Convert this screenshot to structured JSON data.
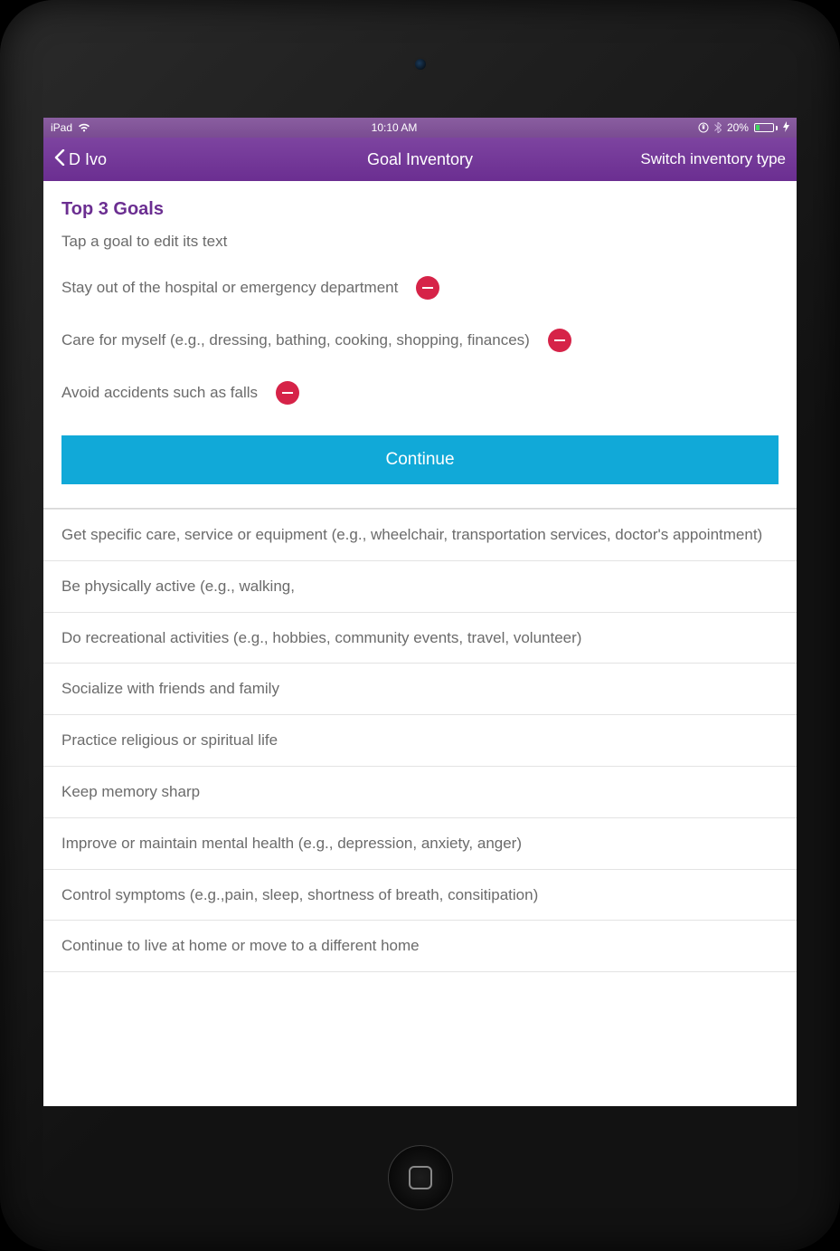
{
  "statusbar": {
    "device": "iPad",
    "time": "10:10 AM",
    "battery_pct": "20%"
  },
  "navbar": {
    "back_label": "D Ivo",
    "title": "Goal Inventory",
    "right_label": "Switch inventory type"
  },
  "top_goals": {
    "title": "Top 3 Goals",
    "subtitle": "Tap a goal to edit its text",
    "items": [
      {
        "text": "Stay out of the hospital or emergency department"
      },
      {
        "text": "Care for myself (e.g., dressing, bathing, cooking, shopping, finances)"
      },
      {
        "text": "Avoid accidents such as falls"
      }
    ],
    "continue_label": "Continue"
  },
  "goal_list": [
    "Get specific care, service or equipment (e.g., wheelchair, transportation services, doctor's appointment)",
    "Be physically active (e.g., walking,",
    "Do recreational activities (e.g., hobbies, community events, travel, volunteer)",
    "Socialize with friends and family",
    "Practice religious or spiritual life",
    "Keep memory sharp",
    "Improve or maintain mental health (e.g., depression, anxiety, anger)",
    "Control symptoms (e.g.,pain, sleep, shortness of breath, consitipation)",
    "Continue to live at home or move to a different home"
  ]
}
